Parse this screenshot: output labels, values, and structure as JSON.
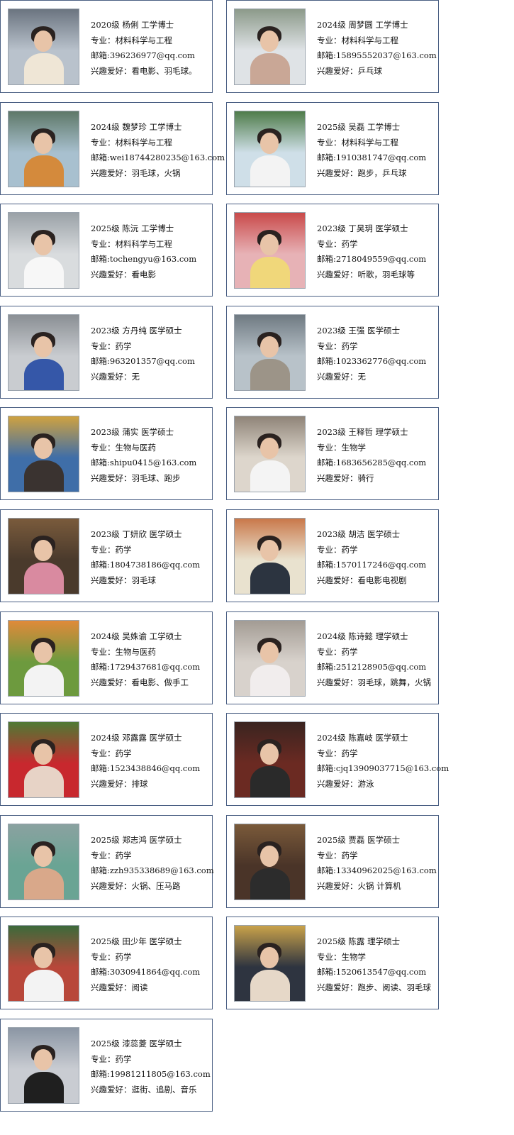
{
  "labels": {
    "major": "专业：",
    "email": "邮箱:",
    "hobby": "兴趣爱好："
  },
  "cards": [
    {
      "title": "2020级 杨俐 工学博士",
      "major": "材料科学与工程",
      "email": "396236977@qq.com",
      "hobby": "看电影、羽毛球。",
      "photo_bg": "#b9c2cc",
      "photo_top": "#6b7480",
      "clothes": "#efe6d6"
    },
    {
      "title": "2024级 周梦圆 工学博士",
      "major": "材料科学与工程",
      "email": "15895552037@163.com",
      "hobby": "乒乓球",
      "photo_bg": "#dfe3e6",
      "photo_top": "#8c9a8a",
      "clothes": "#c9a796"
    },
    {
      "title": "2024级 魏梦珍 工学博士",
      "major": "材料科学与工程",
      "email": "wei18744280235@163.com",
      "hobby": "羽毛球，火锅",
      "photo_bg": "#a8c0cf",
      "photo_top": "#5e7868",
      "clothes": "#d48a3c"
    },
    {
      "title": "2025级 吴磊 工学博士",
      "major": "材料科学与工程",
      "email": "1910381747@qq.com",
      "hobby": "跑步，乒乓球",
      "photo_bg": "#cfdfe8",
      "photo_top": "#4f7c4a",
      "clothes": "#f3f3f3"
    },
    {
      "title": "2025级 陈沅 工学博士",
      "major": "材料科学与工程",
      "email": "tochengyu@163.com",
      "hobby": "看电影",
      "photo_bg": "#d9dcde",
      "photo_top": "#9aa1a7",
      "clothes": "#f7f7f7"
    },
    {
      "title": "2023级 丁昊玥 医学硕士",
      "major": "药学",
      "email": "2718049559@qq.com",
      "hobby": "听歌，羽毛球等",
      "photo_bg": "#e7b2b6",
      "photo_top": "#c94a4a",
      "clothes": "#f0d77a"
    },
    {
      "title": "2023级 方丹纯 医学硕士",
      "major": "药学",
      "email": "963201357@qq.com",
      "hobby": "无",
      "photo_bg": "#c9ccd0",
      "photo_top": "#8a8f94",
      "clothes": "#3557a8"
    },
    {
      "title": "2023级 王强 医学硕士",
      "major": "药学",
      "email": "1023362776@qq.com",
      "hobby": "无",
      "photo_bg": "#b8c2c9",
      "photo_top": "#6f7a82",
      "clothes": "#9c9488"
    },
    {
      "title": "2023级 蒲实 医学硕士",
      "major": "生物与医药",
      "email": "shipu0415@163.com",
      "hobby": "羽毛球、跑步",
      "photo_bg": "#3f6ea8",
      "photo_top": "#cfa240",
      "clothes": "#3a3330"
    },
    {
      "title": "2023级 王释哲 理学硕士",
      "major": "生物学",
      "email": "1683656285@qq.com",
      "hobby": "骑行",
      "photo_bg": "#ddd6cc",
      "photo_top": "#8f8478",
      "clothes": "#f4f4f4"
    },
    {
      "title": "2023级 丁妍欣 医学硕士",
      "major": "药学",
      "email": "1804738186@qq.com",
      "hobby": "羽毛球",
      "photo_bg": "#4a3a2c",
      "photo_top": "#7a5b3c",
      "clothes": "#d98aa0"
    },
    {
      "title": "2023级 胡洁 医学硕士",
      "major": "药学",
      "email": "1570117246@qq.com",
      "hobby": "看电影电视剧",
      "photo_bg": "#e9e2cf",
      "photo_top": "#c9784a",
      "clothes": "#2c3440"
    },
    {
      "title": "2024级 吴姝谕 工学硕士",
      "major": "生物与医药",
      "email": "1729437681@qq.com",
      "hobby": "看电影、做手工",
      "photo_bg": "#6d9a3e",
      "photo_top": "#e08a3a",
      "clothes": "#f3f3f3"
    },
    {
      "title": "2024级 陈诗懿 理学硕士",
      "major": "药学",
      "email": "2512128905@qq.com",
      "hobby": "羽毛球，跳舞，火锅",
      "photo_bg": "#d8d2cc",
      "photo_top": "#a39c94",
      "clothes": "#f1eded"
    },
    {
      "title": "2024级 邓露露 医学硕士",
      "major": "药学",
      "email": "1523438846@qq.com",
      "hobby": "排球",
      "photo_bg": "#c8282e",
      "photo_top": "#4f7a34",
      "clothes": "#e7d3c6"
    },
    {
      "title": "2024级 陈嘉岐 医学硕士",
      "major": "药学",
      "email": "cjq13909037715@163.com",
      "hobby": "游泳",
      "photo_bg": "#6b2a22",
      "photo_top": "#3a2420",
      "clothes": "#2a2a2a"
    },
    {
      "title": "2025级 郑志鸿 医学硕士",
      "major": "药学",
      "email": "zzh935338689@163.com",
      "hobby": "火锅、压马路",
      "photo_bg": "#6aa494",
      "photo_top": "#8aa2a0",
      "clothes": "#d9a88a"
    },
    {
      "title": "2025级 贾磊 医学硕士",
      "major": "药学",
      "email": "13340962025@163.com",
      "hobby": "火锅 计算机",
      "photo_bg": "#4a3428",
      "photo_top": "#7a5a3a",
      "clothes": "#2c2c2c"
    },
    {
      "title": "2025级 田少年 医学硕士",
      "major": "药学",
      "email": "3030941864@qq.com",
      "hobby": "阅读",
      "photo_bg": "#b8473a",
      "photo_top": "#3c6a3a",
      "clothes": "#f3f3f3"
    },
    {
      "title": "2025级 陈露 理学硕士",
      "major": "生物学",
      "email": "1520613547@qq.com",
      "hobby": "跑步、阅读、羽毛球",
      "photo_bg": "#2e3440",
      "photo_top": "#c9a24a",
      "clothes": "#e6d8c8"
    },
    {
      "title": "2025级 漆蕊菱 医学硕士",
      "major": "药学",
      "email": "19981211805@163.com",
      "hobby": "逛街、追剧、音乐",
      "photo_bg": "#c9ccd2",
      "photo_top": "#8b96a4",
      "clothes": "#1f1f1f"
    }
  ]
}
